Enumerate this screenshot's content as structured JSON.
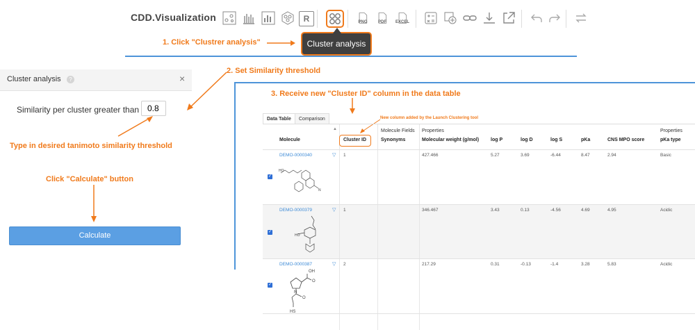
{
  "toolbar": {
    "logo": "CDD.Visualization",
    "file_buttons": [
      "PNG",
      "PDF",
      "EXCEL"
    ],
    "r_label": "R",
    "tooltip": "Cluster analysis"
  },
  "annotations": {
    "step1": "1. Click \"Clustrer analysis\"",
    "step2": "2. Set Similarity threshold",
    "step3": "3. Receive new \"Cluster ID\" column in the data table",
    "type_threshold": "Type in desired tanimoto similarity threshold",
    "click_calculate": "Click \"Calculate\" button",
    "new_column": "New column added by the Launch Clustering tool"
  },
  "panel": {
    "title": "Cluster analysis",
    "help": "?",
    "close": "×",
    "similarity_label": "Similarity per cluster greater than",
    "similarity_value": "0.8",
    "calculate_label": "Calculate"
  },
  "table": {
    "tabs": [
      "Data Table",
      "Comparison"
    ],
    "groups": {
      "fields": "Molecule Fields",
      "properties": "Properties",
      "properties2": "Properties"
    },
    "headers": {
      "molecule": "Molecule",
      "cluster_id": "Cluster ID",
      "synonyms": "Synonyms",
      "mw": "Molecular weight (g/mol)",
      "logp": "log P",
      "logd": "log D",
      "logs": "log S",
      "pka": "pKa",
      "cns": "CNS MPO score",
      "pka_type": "pKa type"
    },
    "rows": [
      {
        "id": "DEMO-0000340",
        "cluster": "1",
        "mw": "427.466",
        "logp": "5.27",
        "logd": "3.69",
        "logs": "-6.44",
        "pka": "8.47",
        "cns": "2.94",
        "pka_type": "Basic"
      },
      {
        "id": "DEMO-0000379",
        "cluster": "1",
        "mw": "346.467",
        "logp": "3.43",
        "logd": "0.13",
        "logs": "-4.56",
        "pka": "4.69",
        "cns": "4.95",
        "pka_type": "Acidic"
      },
      {
        "id": "DEMO-0000387",
        "cluster": "2",
        "mw": "217.29",
        "logp": "0.31",
        "logd": "-0.13",
        "logs": "-1.4",
        "pka": "3.28",
        "cns": "5.83",
        "pka_type": "Acidic"
      }
    ],
    "structure_labels": {
      "oh": "OH",
      "o": "O",
      "n": "N",
      "hs": "HS"
    }
  },
  "colors": {
    "accent": "#f07a1b",
    "line": "#4d94d9",
    "button": "#5b9fe3"
  }
}
